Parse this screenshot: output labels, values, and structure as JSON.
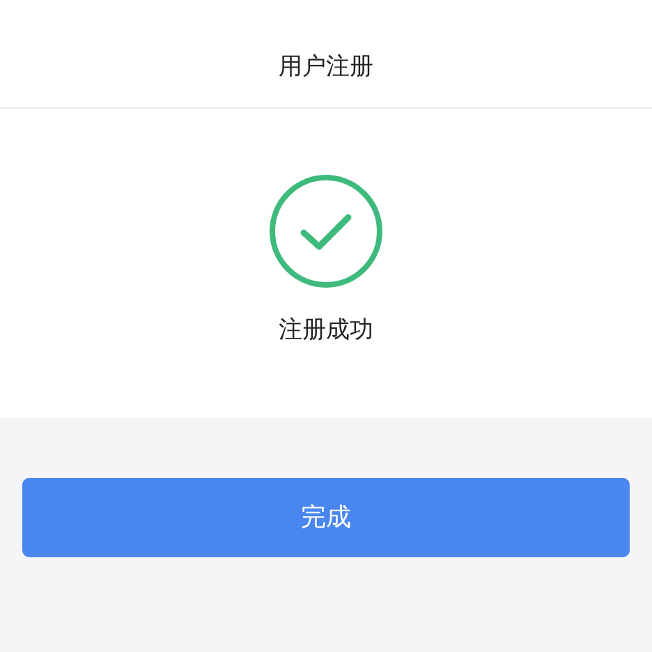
{
  "header": {
    "title": "用户注册"
  },
  "result": {
    "success": true,
    "message": "注册成功"
  },
  "buttons": [
    {
      "label": "完成"
    }
  ]
}
